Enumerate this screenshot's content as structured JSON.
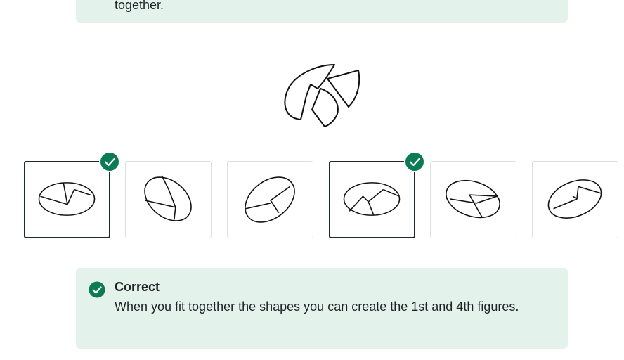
{
  "top_banner": {
    "text": "together."
  },
  "question": {
    "figure_icon": "pieces-to-assemble-icon"
  },
  "options": [
    {
      "name": "option-1",
      "selected": true,
      "icon": "ellipse-split-figure-1-icon"
    },
    {
      "name": "option-2",
      "selected": false,
      "icon": "ellipse-split-figure-2-icon"
    },
    {
      "name": "option-3",
      "selected": false,
      "icon": "ellipse-split-figure-3-icon"
    },
    {
      "name": "option-4",
      "selected": true,
      "icon": "ellipse-split-figure-4-icon"
    },
    {
      "name": "option-5",
      "selected": false,
      "icon": "ellipse-split-figure-5-icon"
    },
    {
      "name": "option-6",
      "selected": false,
      "icon": "ellipse-split-figure-6-icon"
    }
  ],
  "feedback": {
    "title": "Correct",
    "text": "When you fit together the shapes you can create the 1st and 4th figures.",
    "icon": "check-circle-icon",
    "color": "#0a7b55"
  },
  "colors": {
    "success": "#0a7b55",
    "banner_bg": "#e4f2ec",
    "selected_border": "#1e2a2f"
  }
}
